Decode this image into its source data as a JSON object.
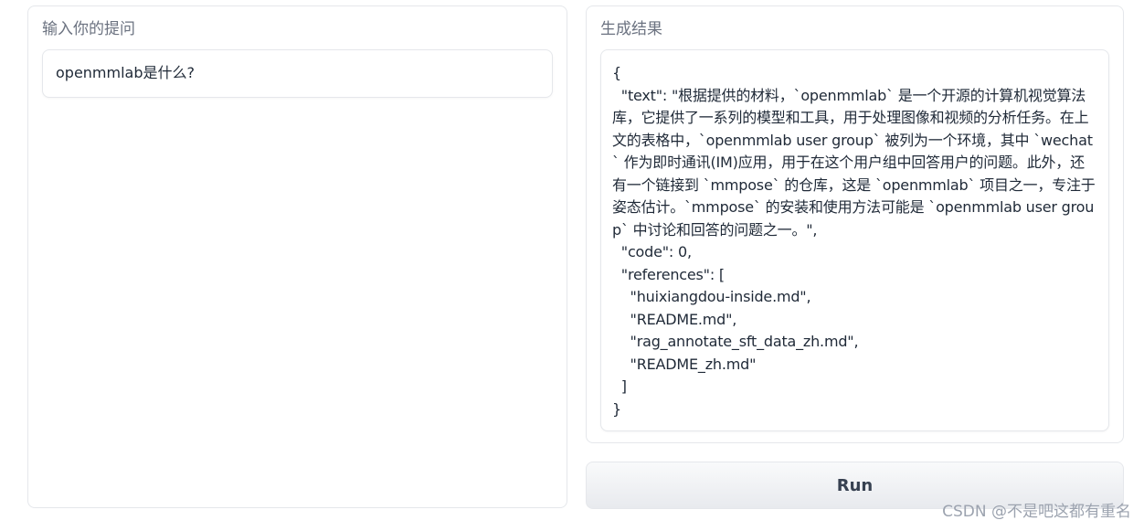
{
  "input_panel": {
    "label": "输入你的提问",
    "value": "openmmlab是什么?"
  },
  "output_panel": {
    "label": "生成结果",
    "value": "{\n  \"text\": \"根据提供的材料，`openmmlab` 是一个开源的计算机视觉算法库，它提供了一系列的模型和工具，用于处理图像和视频的分析任务。在上文的表格中，`openmmlab user group` 被列为一个环境，其中 `wechat` 作为即时通讯(IM)应用，用于在这个用户组中回答用户的问题。此外，还有一个链接到 `mmpose` 的仓库，这是 `openmmlab` 项目之一，专注于姿态估计。`mmpose` 的安装和使用方法可能是 `openmmlab user group` 中讨论和回答的问题之一。\",\n  \"code\": 0,\n  \"references\": [\n    \"huixiangdou-inside.md\",\n    \"README.md\",\n    \"rag_annotate_sft_data_zh.md\",\n    \"README_zh.md\"\n  ]\n}"
  },
  "run_button": {
    "label": "Run"
  },
  "watermark": {
    "text": "CSDN @不是吧这都有重名"
  }
}
